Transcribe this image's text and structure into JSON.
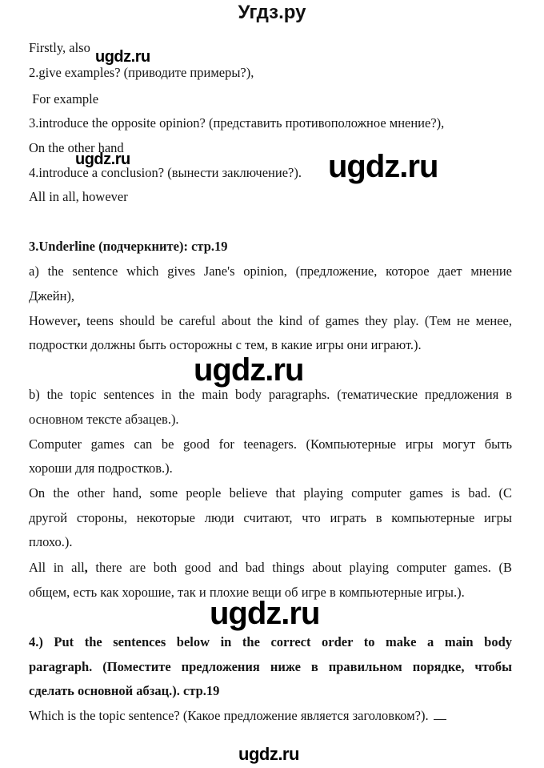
{
  "header": {
    "site_title": "Угдз.ру"
  },
  "watermark": {
    "text": "ugdz.ru"
  },
  "content": {
    "l1": "Firstly, also",
    "l2": "2.give examples? (приводите примеры?),",
    "l3": " For example",
    "l4": "3.introduce the opposite opinion? (представить противоположное мнение?),",
    "l5": "On the other hand",
    "l6": "4.introduce a conclusion? (вынести заключение?).",
    "l7": "All in all, however",
    "section3": {
      "heading": "3.Underline (подчеркните): стр.19",
      "a_line1": "a) the sentence which gives Jane's opinion,  (предложение, которое дает  мнение",
      "a_line2": "Джейн),",
      "a_ans1_lead": "However",
      "a_ans1_comma": ",",
      "a_ans1_rest": " teens should be careful about the kind of games they play. (Тем не менее,",
      "a_ans2": "подростки должны быть осторожны с тем, в какие игры они играют.).",
      "b_line1": "b) the topic sentences in the main body paragraphs. (тематические предложения в",
      "b_line2": "основном тексте абзацев.).",
      "b_ans1_line1": "Computer games can be good for teenagers. (Компьютерные игры могут быть",
      "b_ans1_line2": "хороши для подростков.).",
      "b_ans2_line1": "On the other hand, some people believe that playing computer games is bad. (С",
      "b_ans2_line2": "другой стороны, некоторые люди считают, что играть в компьютерные игры",
      "b_ans2_line3": "плохо.).",
      "b_ans3_lead": "All in all",
      "b_ans3_comma": ",",
      "b_ans3_rest": " there are both good and bad things about playing computer games. (В",
      "b_ans3_line2": "общем, есть как хорошие, так и плохие вещи об игре в компьютерные игры.)."
    },
    "section4": {
      "heading_line1": "4.) Put the sentences below in the correct order to make a main body",
      "heading_line2": "paragraph. (Поместите предложения ниже в правильном порядке, чтобы",
      "heading_line3": "сделать основной абзац.). стр.19",
      "question": "Which is the topic sentence? (Какое предложение является заголовком?)."
    }
  }
}
